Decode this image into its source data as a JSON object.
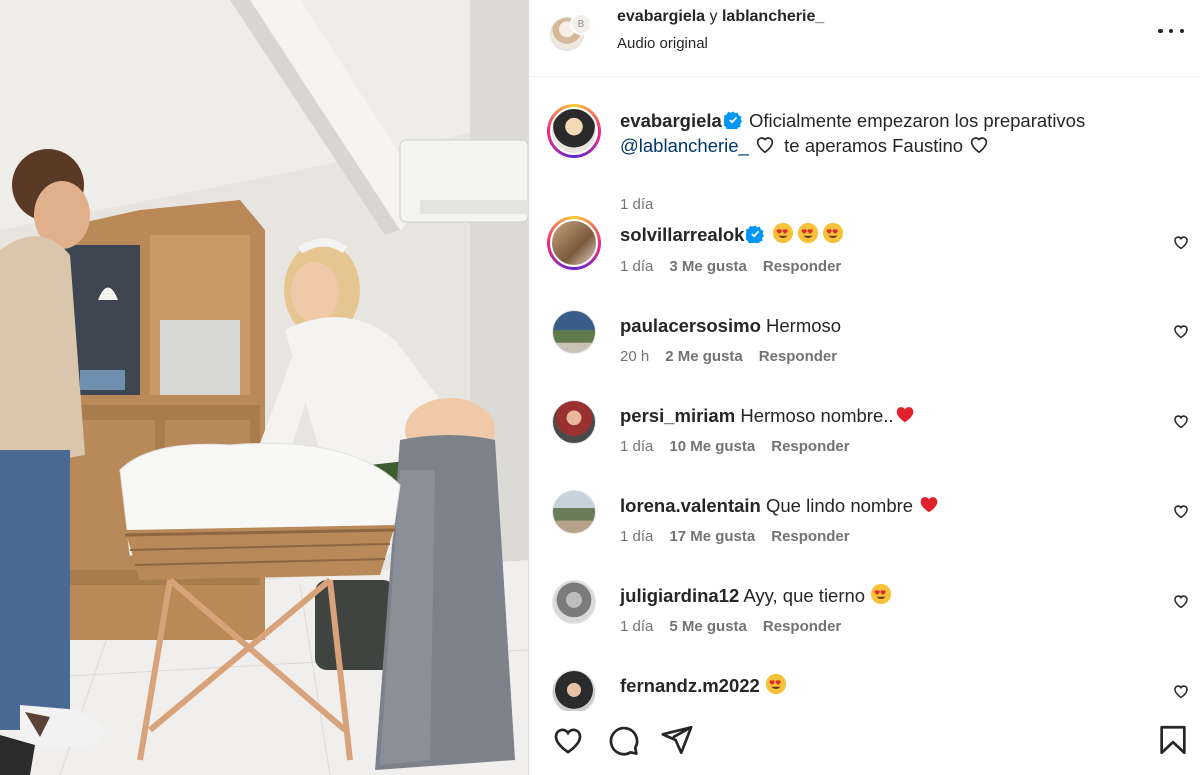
{
  "header": {
    "author": "evabargiela",
    "connector": "y",
    "collaborator": "lablancherie_",
    "audio": "Audio original",
    "badge_letter": "B"
  },
  "caption": {
    "username": "evabargiela",
    "text_line1": "Oficialmente empezaron los preparativos",
    "mention": "@lablancherie_",
    "text_line2": "te aperamos Faustino",
    "time": "1 día"
  },
  "comments": [
    {
      "username": "solvillarrealok",
      "verified": true,
      "text": "",
      "emojis": [
        "heart-eyes-emoji",
        "heart-eyes-emoji",
        "heart-eyes-emoji"
      ],
      "time": "1 día",
      "likes": "3 Me gusta",
      "reply": "Responder"
    },
    {
      "username": "paulacersosimo",
      "verified": false,
      "text": "Hermoso",
      "emojis": [],
      "time": "20 h",
      "likes": "2 Me gusta",
      "reply": "Responder"
    },
    {
      "username": "persi_miriam",
      "verified": false,
      "text": "Hermoso nombre..",
      "emojis": [
        "red-heart-emoji"
      ],
      "time": "1 día",
      "likes": "10 Me gusta",
      "reply": "Responder"
    },
    {
      "username": "lorena.valentain",
      "verified": false,
      "text": "Que lindo nombre",
      "emojis": [
        "red-heart-emoji"
      ],
      "time": "1 día",
      "likes": "17 Me gusta",
      "reply": "Responder"
    },
    {
      "username": "juligiardina12",
      "verified": false,
      "text": "Ayy, que tierno",
      "emojis": [
        "heart-eyes-emoji"
      ],
      "time": "1 día",
      "likes": "5 Me gusta",
      "reply": "Responder"
    },
    {
      "username": "fernandz.m2022",
      "verified": false,
      "text": "",
      "emojis": [
        "heart-eyes-emoji"
      ],
      "time": "",
      "likes": "",
      "reply": ""
    }
  ],
  "icons": {
    "more": "more-options-icon",
    "like": "heart-outline-icon",
    "comment": "comment-bubble-icon",
    "share": "paper-plane-icon",
    "save": "bookmark-icon",
    "verified": "verified-badge-icon"
  },
  "colors": {
    "text": "#262626",
    "secondary": "#737373",
    "verified": "#0095f6",
    "mention": "#00376b",
    "border": "#efefef"
  }
}
